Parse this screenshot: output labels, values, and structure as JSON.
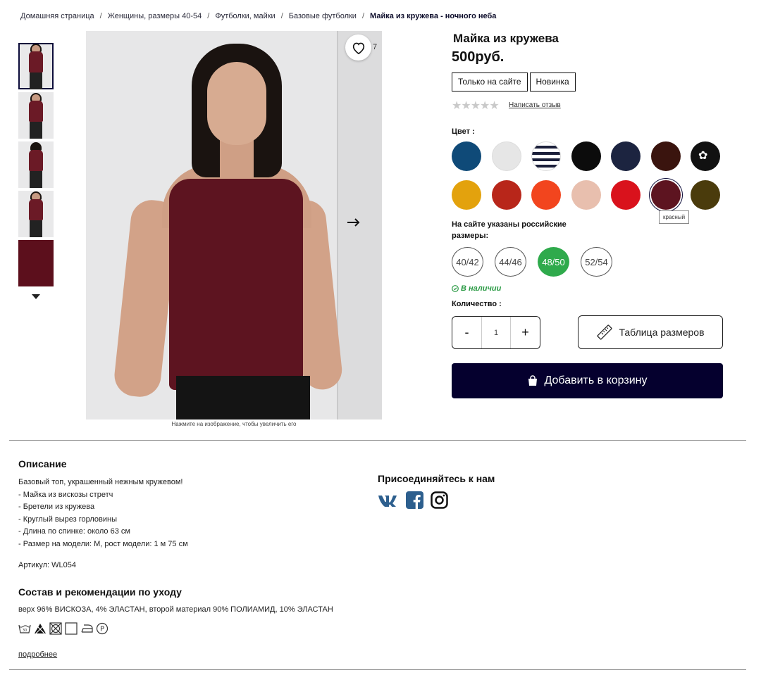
{
  "breadcrumb": {
    "items": [
      "Домашняя страница",
      "Женщины, размеры 40-54",
      "Футболки, майки",
      "Базовые футболки"
    ],
    "current": "Майка из кружева - ночного неба",
    "separator": "/"
  },
  "gallery": {
    "thumbnails": [
      "front",
      "side",
      "back",
      "arm-raised",
      "fabric"
    ],
    "favorites_count": "7",
    "zoom_hint": "Нажмите на изображение, чтобы увеличить его"
  },
  "product": {
    "title": "Майка из кружева",
    "price": "500руб.",
    "badges": [
      "Только на сайте",
      "Новинка"
    ],
    "stars": "★★★★★",
    "review_link": "Написать отзыв",
    "color_label": "Цвет :",
    "colors": [
      "#0f4a78",
      "#e6e6e6",
      "stripes",
      "#0c0c0c",
      "#1c2440",
      "#3a140e",
      "print",
      "#e3a20d",
      "#b8261a",
      "#f2451e",
      "#e8bfae",
      "#d9121c",
      "#5d1420",
      "#4a3b0c"
    ],
    "selected_color_index": 12,
    "color_tooltip": "красный",
    "size_note": "На сайте указаны российские размеры:",
    "sizes": [
      "40/42",
      "44/46",
      "48/50",
      "52/54"
    ],
    "selected_size_index": 2,
    "stock": "В наличии",
    "quantity_label": "Количество :",
    "quantity": {
      "minus": "-",
      "value": "1",
      "plus": "+"
    },
    "size_table": "Таблица размеров",
    "add_to_cart": "Добавить в корзину"
  },
  "description": {
    "title": "Описание",
    "lines": [
      "Базовый топ, украшенный нежным кружевом!",
      "- Майка из вискозы стретч",
      "- Бретели из кружева",
      "- Круглый вырез горловины",
      "- Длина по спинке: около 63 см",
      "- Размер на модели: M, рост модели: 1 м 75 см"
    ],
    "sku": "Артикул: WL054"
  },
  "composition": {
    "title": "Состав и рекомендации по уходу",
    "text": "верх 96% ВИСКОЗА, 4% ЭЛАСТАН, второй материал 90% ПОЛИАМИД, 10% ЭЛАСТАН",
    "care_icons": [
      "wash-30-icon",
      "no-bleach-icon",
      "no-tumble-dry-icon",
      "dry-flat-icon",
      "iron-low-icon",
      "dry-clean-p-icon"
    ],
    "more": "подробнее"
  },
  "social": {
    "title": "Присоединяйтесь к нам",
    "networks": [
      "vk-icon",
      "facebook-icon",
      "instagram-icon"
    ],
    "brand_color": "#2d5f8e"
  },
  "colors": {
    "primary_dark": "#05002e",
    "in_stock_green": "#2a9a44",
    "size_selected_green": "#2faa4c"
  }
}
